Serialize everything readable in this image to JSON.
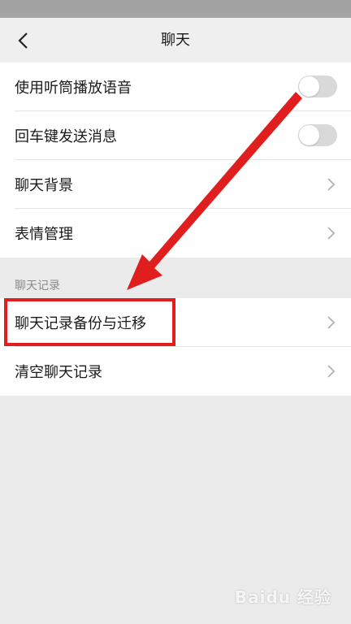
{
  "nav": {
    "title": "聊天"
  },
  "settings": {
    "items": [
      {
        "label": "使用听筒播放语音",
        "control": "toggle",
        "on": false
      },
      {
        "label": "回车键发送消息",
        "control": "toggle",
        "on": false
      },
      {
        "label": "聊天背景",
        "control": "chevron"
      },
      {
        "label": "表情管理",
        "control": "chevron"
      }
    ]
  },
  "chat_history": {
    "header": "聊天记录",
    "items": [
      {
        "label": "聊天记录备份与迁移",
        "control": "chevron"
      },
      {
        "label": "清空聊天记录",
        "control": "chevron"
      }
    ]
  },
  "watermark": {
    "text": "Baidu 经验"
  },
  "colors": {
    "highlight": "#e01e1e",
    "toggle_off": "#d9d9d9",
    "page_bg": "#ebebeb"
  },
  "icons": {
    "back": "chevron-left-icon",
    "row_arrow": "chevron-right-icon",
    "annotation": "red-arrow-icon"
  }
}
